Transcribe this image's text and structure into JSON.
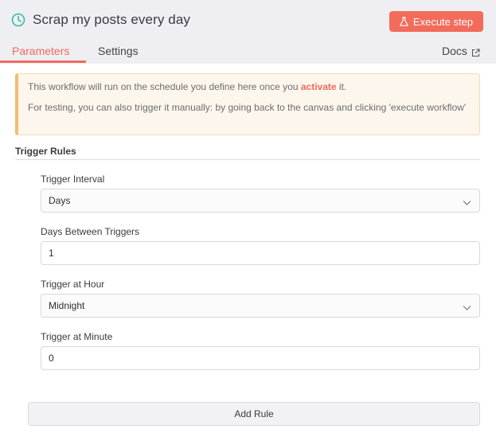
{
  "header": {
    "title": "Scrap my posts every day",
    "execute_label": "Execute step",
    "tabs": [
      "Parameters",
      "Settings"
    ],
    "docs_label": "Docs"
  },
  "notice": {
    "line1_before": "This workflow will run on the schedule you define here once you ",
    "line1_link": "activate",
    "line1_after": " it.",
    "line2": "For testing, you can also trigger it manually: by going back to the canvas and clicking 'execute workflow'"
  },
  "section": {
    "title": "Trigger Rules"
  },
  "fields": [
    {
      "label": "Trigger Interval",
      "value": "Days",
      "type": "select"
    },
    {
      "label": "Days Between Triggers",
      "value": "1",
      "type": "input"
    },
    {
      "label": "Trigger at Hour",
      "value": "Midnight",
      "type": "select"
    },
    {
      "label": "Trigger at Minute",
      "value": "0",
      "type": "input"
    }
  ],
  "add_rule_label": "Add Rule",
  "colors": {
    "accent": "#f26b5b",
    "clock": "#3cbaa5",
    "notice_border": "#f3bb73"
  },
  "icons": {
    "title": "clock-icon",
    "execute": "flask-icon",
    "docs": "external-link-icon",
    "select": "chevron-down-icon"
  }
}
